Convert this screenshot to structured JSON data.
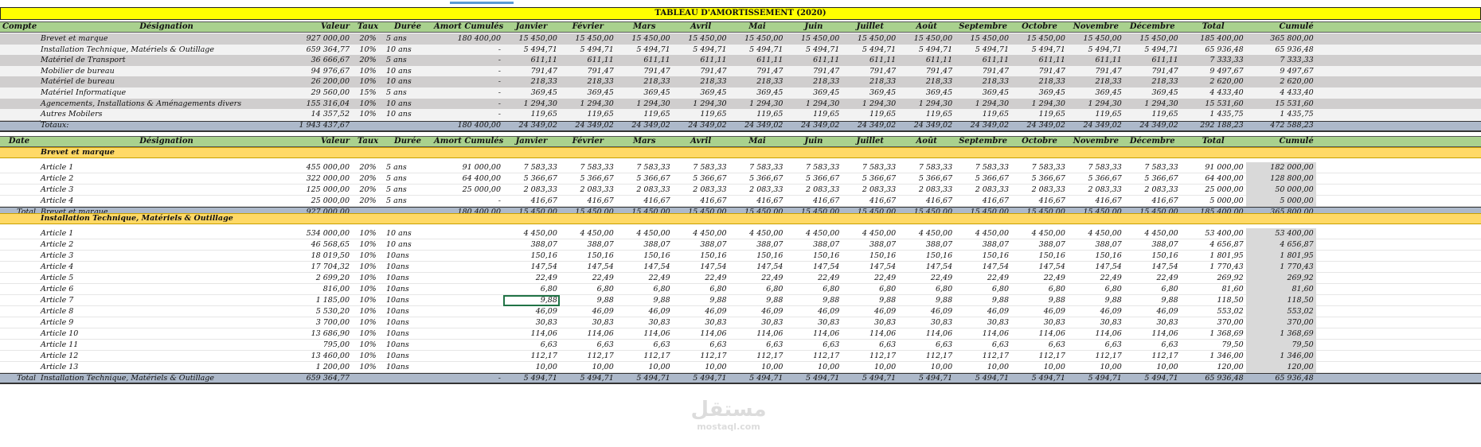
{
  "title": "TABLEAU D'AMORTISSEMENT (2020)",
  "header1": {
    "compte": "Compte",
    "designation": "Désignation",
    "valeur": "Valeur",
    "taux": "Taux",
    "duree": "Durée",
    "amort": "Amort Cumulés",
    "months": [
      "Janvier",
      "Février",
      "Mars",
      "Avril",
      "Mai",
      "Juin",
      "Juillet",
      "Août",
      "Septembre",
      "Octobre",
      "Novembre",
      "Décembre"
    ],
    "total": "Total",
    "cumule": "Cumulé"
  },
  "summary_rows": [
    {
      "designation": "Brevet et marque",
      "valeur": "927 000,00",
      "taux": "20%",
      "duree": "5 ans",
      "amort": "180 400,00",
      "m": "15 450,00",
      "total": "185 400,00",
      "cumule": "365 800,00"
    },
    {
      "designation": "Installation Technique, Matériels & Outillage",
      "valeur": "659 364,77",
      "taux": "10%",
      "duree": "10 ans",
      "amort": "-",
      "m": "5 494,71",
      "total": "65 936,48",
      "cumule": "65 936,48"
    },
    {
      "designation": "Matériel de Transport",
      "valeur": "36 666,67",
      "taux": "20%",
      "duree": "5 ans",
      "amort": "-",
      "m": "611,11",
      "total": "7 333,33",
      "cumule": "7 333,33"
    },
    {
      "designation": "Mobilier de bureau",
      "valeur": "94 976,67",
      "taux": "10%",
      "duree": "10 ans",
      "amort": "-",
      "m": "791,47",
      "total": "9 497,67",
      "cumule": "9 497,67"
    },
    {
      "designation": "Matériel de bureau",
      "valeur": "26 200,00",
      "taux": "10%",
      "duree": "10 ans",
      "amort": "-",
      "m": "218,33",
      "total": "2 620,00",
      "cumule": "2 620,00"
    },
    {
      "designation": "Matériel Informatique",
      "valeur": "29 560,00",
      "taux": "15%",
      "duree": "5 ans",
      "amort": "-",
      "m": "369,45",
      "total": "4 433,40",
      "cumule": "4 433,40"
    },
    {
      "designation": "Agencements, Installations & Aménagements divers",
      "valeur": "155 316,04",
      "taux": "10%",
      "duree": "10 ans",
      "amort": "-",
      "m": "1 294,30",
      "total": "15 531,60",
      "cumule": "15 531,60"
    },
    {
      "designation": "Autres Mobilers",
      "valeur": "14 357,52",
      "taux": "10%",
      "duree": "10 ans",
      "amort": "-",
      "m": "119,65",
      "total": "1 435,75",
      "cumule": "1 435,75"
    }
  ],
  "summary_total": {
    "label": "Totaux:",
    "valeur": "1 943 437,67",
    "amort": "180 400,00",
    "m": "24 349,02",
    "total": "292 188,23",
    "cumule": "472 588,23"
  },
  "header2": {
    "date": "Date"
  },
  "section1": {
    "name": "Brevet et marque",
    "rows": [
      {
        "designation": "Article 1",
        "valeur": "455 000,00",
        "taux": "20%",
        "duree": "5 ans",
        "amort": "91 000,00",
        "m": "7 583,33",
        "total": "91 000,00",
        "cumule": "182 000,00"
      },
      {
        "designation": "Article 2",
        "valeur": "322 000,00",
        "taux": "20%",
        "duree": "5 ans",
        "amort": "64 400,00",
        "m": "5 366,67",
        "total": "64 400,00",
        "cumule": "128 800,00"
      },
      {
        "designation": "Article 3",
        "valeur": "125 000,00",
        "taux": "20%",
        "duree": "5 ans",
        "amort": "25 000,00",
        "m": "2 083,33",
        "total": "25 000,00",
        "cumule": "50 000,00"
      },
      {
        "designation": "Article 4",
        "valeur": "25 000,00",
        "taux": "20%",
        "duree": "5 ans",
        "amort": "-",
        "m": "416,67",
        "total": "5 000,00",
        "cumule": "5 000,00"
      }
    ],
    "total": {
      "label": "Total",
      "designation": "Brevet et marque",
      "valeur": "927 000,00",
      "amort": "180 400,00",
      "m": "15 450,00",
      "total": "185 400,00",
      "cumule": "365 800,00"
    }
  },
  "section2": {
    "name": "Installation Technique, Matériels & Outillage",
    "rows": [
      {
        "designation": "Article 1",
        "valeur": "534 000,00",
        "taux": "10%",
        "duree": "10 ans",
        "amort": "",
        "m": "4 450,00",
        "total": "53 400,00",
        "cumule": "53 400,00"
      },
      {
        "designation": "Article 2",
        "valeur": "46 568,65",
        "taux": "10%",
        "duree": "10 ans",
        "amort": "",
        "m": "388,07",
        "total": "4 656,87",
        "cumule": "4 656,87"
      },
      {
        "designation": "Article 3",
        "valeur": "18 019,50",
        "taux": "10%",
        "duree": "10ans",
        "amort": "",
        "m": "150,16",
        "total": "1 801,95",
        "cumule": "1 801,95"
      },
      {
        "designation": "Article 4",
        "valeur": "17 704,32",
        "taux": "10%",
        "duree": "10ans",
        "amort": "",
        "m": "147,54",
        "total": "1 770,43",
        "cumule": "1 770,43"
      },
      {
        "designation": "Article 5",
        "valeur": "2 699,20",
        "taux": "10%",
        "duree": "10ans",
        "amort": "",
        "m": "22,49",
        "total": "269,92",
        "cumule": "269,92"
      },
      {
        "designation": "Article 6",
        "valeur": "816,00",
        "taux": "10%",
        "duree": "10ans",
        "amort": "",
        "m": "6,80",
        "total": "81,60",
        "cumule": "81,60"
      },
      {
        "designation": "Article 7",
        "valeur": "1 185,00",
        "taux": "10%",
        "duree": "10ans",
        "amort": "",
        "m": "9,88",
        "total": "118,50",
        "cumule": "118,50"
      },
      {
        "designation": "Article 8",
        "valeur": "5 530,20",
        "taux": "10%",
        "duree": "10ans",
        "amort": "",
        "m": "46,09",
        "total": "553,02",
        "cumule": "553,02"
      },
      {
        "designation": "Article 9",
        "valeur": "3 700,00",
        "taux": "10%",
        "duree": "10ans",
        "amort": "",
        "m": "30,83",
        "total": "370,00",
        "cumule": "370,00"
      },
      {
        "designation": "Article 10",
        "valeur": "13 686,90",
        "taux": "10%",
        "duree": "10ans",
        "amort": "",
        "m": "114,06",
        "total": "1 368,69",
        "cumule": "1 368,69"
      },
      {
        "designation": "Article 11",
        "valeur": "795,00",
        "taux": "10%",
        "duree": "10ans",
        "amort": "",
        "m": "6,63",
        "total": "79,50",
        "cumule": "79,50"
      },
      {
        "designation": "Article 12",
        "valeur": "13 460,00",
        "taux": "10%",
        "duree": "10ans",
        "amort": "",
        "m": "112,17",
        "total": "1 346,00",
        "cumule": "1 346,00"
      },
      {
        "designation": "Article 13",
        "valeur": "1 200,00",
        "taux": "10%",
        "duree": "10ans",
        "amort": "",
        "m": "10,00",
        "total": "120,00",
        "cumule": "120,00"
      }
    ],
    "total": {
      "label": "Total",
      "designation": "Installation Technique, Matériels & Outillage",
      "valeur": "659 364,77",
      "amort": "-",
      "m": "5 494,71",
      "total": "65 936,48",
      "cumule": "65 936,48"
    }
  },
  "watermark": {
    "arabic": "مستقل",
    "latin": "mostaql.com"
  }
}
